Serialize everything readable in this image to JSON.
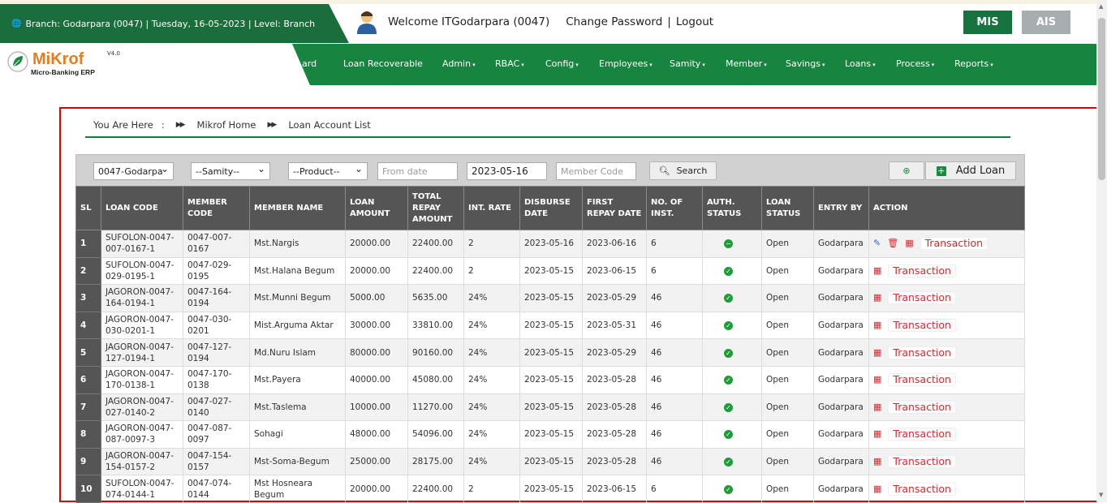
{
  "branch_info": "Branch: Godarpara (0047) | Tuesday, 16-05-2023 | Level: Branch",
  "welcome": "Welcome ITGodarpara (0047)",
  "change_password": "Change Password",
  "logout": "Logout",
  "mis_label": "MIS",
  "ais_label": "AIS",
  "logo": {
    "name_m": "Mi",
    "name_rest": "Krof",
    "version": "V4.0",
    "subtitle": "Micro-Banking ERP"
  },
  "nav": {
    "dashboard": "ard",
    "loan_recoverable": "Loan Recoverable",
    "admin": "Admin",
    "rbac": "RBAC",
    "config": "Config",
    "employees": "Employees",
    "samity": "Samity",
    "member": "Member",
    "savings": "Savings",
    "loans": "Loans",
    "process": "Process",
    "reports": "Reports"
  },
  "breadcrumb": {
    "you_are_here": "You Are Here",
    "colon": ":",
    "home": "Mikrof Home",
    "current": "Loan Account List"
  },
  "filters": {
    "branch": "0047-Godarpa",
    "samity": "--Samity--",
    "product": "--Product--",
    "from_date_placeholder": "From date",
    "to_date": "2023-05-16",
    "member_code_placeholder": "Member Code",
    "search_label": "Search",
    "add_loan_label": "Add Loan"
  },
  "table": {
    "headers": [
      "SL",
      "LOAN CODE",
      "MEMBER CODE",
      "MEMBER NAME",
      "LOAN AMOUNT",
      "TOTAL REPAY AMOUNT",
      "INT. RATE",
      "DISBURSE DATE",
      "FIRST REPAY DATE",
      "NO. OF INST.",
      "AUTH. STATUS",
      "LOAN STATUS",
      "ENTRY BY",
      "ACTION"
    ],
    "transaction_label": "Transaction",
    "rows": [
      {
        "sl": "1",
        "loan_code": "SUFOLON-0047-007-0167-1",
        "member_code": "0047-007-0167",
        "member_name": "Mst.Nargis",
        "loan_amount": "20000.00",
        "total_repay": "22400.00",
        "int_rate": "2",
        "disburse_date": "2023-05-16",
        "first_repay": "2023-06-16",
        "inst": "6",
        "auth": "pending",
        "loan_status": "Open",
        "entry_by": "Godarpara"
      },
      {
        "sl": "2",
        "loan_code": "SUFOLON-0047-029-0195-1",
        "member_code": "0047-029-0195",
        "member_name": "Mst.Halana Begum",
        "loan_amount": "20000.00",
        "total_repay": "22400.00",
        "int_rate": "2",
        "disburse_date": "2023-05-15",
        "first_repay": "2023-06-15",
        "inst": "6",
        "auth": "approved",
        "loan_status": "Open",
        "entry_by": "Godarpara"
      },
      {
        "sl": "3",
        "loan_code": "JAGORON-0047-164-0194-1",
        "member_code": "0047-164-0194",
        "member_name": "Mst.Munni Begum",
        "loan_amount": "5000.00",
        "total_repay": "5635.00",
        "int_rate": "24%",
        "disburse_date": "2023-05-15",
        "first_repay": "2023-05-29",
        "inst": "46",
        "auth": "approved",
        "loan_status": "Open",
        "entry_by": "Godarpara"
      },
      {
        "sl": "4",
        "loan_code": "JAGORON-0047-030-0201-1",
        "member_code": "0047-030-0201",
        "member_name": "Mist.Arguma Aktar",
        "loan_amount": "30000.00",
        "total_repay": "33810.00",
        "int_rate": "24%",
        "disburse_date": "2023-05-15",
        "first_repay": "2023-05-31",
        "inst": "46",
        "auth": "approved",
        "loan_status": "Open",
        "entry_by": "Godarpara"
      },
      {
        "sl": "5",
        "loan_code": "JAGORON-0047-127-0194-1",
        "member_code": "0047-127-0194",
        "member_name": "Md.Nuru Islam",
        "loan_amount": "80000.00",
        "total_repay": "90160.00",
        "int_rate": "24%",
        "disburse_date": "2023-05-15",
        "first_repay": "2023-05-29",
        "inst": "46",
        "auth": "approved",
        "loan_status": "Open",
        "entry_by": "Godarpara"
      },
      {
        "sl": "6",
        "loan_code": "JAGORON-0047-170-0138-1",
        "member_code": "0047-170-0138",
        "member_name": "Mst.Payera",
        "loan_amount": "40000.00",
        "total_repay": "45080.00",
        "int_rate": "24%",
        "disburse_date": "2023-05-15",
        "first_repay": "2023-05-28",
        "inst": "46",
        "auth": "approved",
        "loan_status": "Open",
        "entry_by": "Godarpara"
      },
      {
        "sl": "7",
        "loan_code": "JAGORON-0047-027-0140-2",
        "member_code": "0047-027-0140",
        "member_name": "Mst.Taslema",
        "loan_amount": "10000.00",
        "total_repay": "11270.00",
        "int_rate": "24%",
        "disburse_date": "2023-05-15",
        "first_repay": "2023-05-28",
        "inst": "46",
        "auth": "approved",
        "loan_status": "Open",
        "entry_by": "Godarpara"
      },
      {
        "sl": "8",
        "loan_code": "JAGORON-0047-087-0097-3",
        "member_code": "0047-087-0097",
        "member_name": "Sohagi",
        "loan_amount": "48000.00",
        "total_repay": "54096.00",
        "int_rate": "24%",
        "disburse_date": "2023-05-15",
        "first_repay": "2023-05-28",
        "inst": "46",
        "auth": "approved",
        "loan_status": "Open",
        "entry_by": "Godarpara"
      },
      {
        "sl": "9",
        "loan_code": "JAGORON-0047-154-0157-2",
        "member_code": "0047-154-0157",
        "member_name": "Mst-Soma-Begum",
        "loan_amount": "25000.00",
        "total_repay": "28175.00",
        "int_rate": "24%",
        "disburse_date": "2023-05-15",
        "first_repay": "2023-05-28",
        "inst": "46",
        "auth": "approved",
        "loan_status": "Open",
        "entry_by": "Godarpara"
      },
      {
        "sl": "10",
        "loan_code": "SUFOLON-0047-074-0144-1",
        "member_code": "0047-074-0144",
        "member_name": "Mst Hosneara Begum",
        "loan_amount": "20000.00",
        "total_repay": "22400.00",
        "int_rate": "2",
        "disburse_date": "2023-05-15",
        "first_repay": "2023-06-15",
        "inst": "6",
        "auth": "approved",
        "loan_status": "Open",
        "entry_by": "Godarpara"
      }
    ]
  },
  "colors": {
    "brand_green": "#17843f",
    "header_green": "#1a6e3c",
    "danger": "#d9292e",
    "table_header": "#555555"
  }
}
